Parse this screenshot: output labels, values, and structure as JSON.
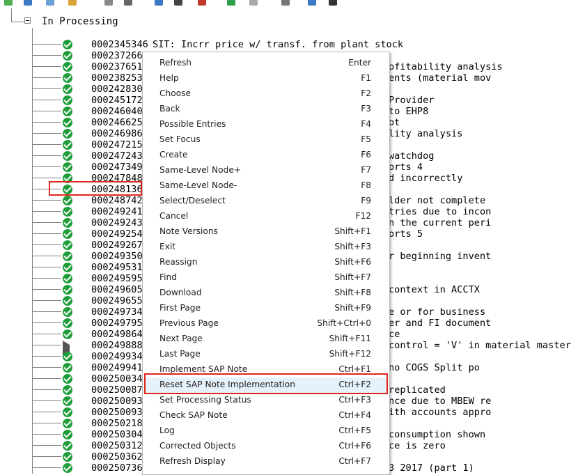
{
  "tree": {
    "root_label": "In Processing",
    "rows": [
      {
        "number": "0002345346",
        "desc": "SIT: Incrr price w/ transf. from plant stock",
        "full": true,
        "status": "check"
      },
      {
        "number": "000237266",
        "desc": "",
        "status": "check"
      },
      {
        "number": "000237651",
        "desc": "ofitability analysis",
        "status": "check"
      },
      {
        "number": "000238253",
        "desc": "ents (material mov",
        "status": "check"
      },
      {
        "number": "000242830",
        "desc": "",
        "status": "check"
      },
      {
        "number": "000245172",
        "desc": "Provider",
        "status": "check"
      },
      {
        "number": "000246040",
        "desc": "to EHP8",
        "status": "check"
      },
      {
        "number": "000246625",
        "desc": "ot",
        "status": "check"
      },
      {
        "number": "000246986",
        "desc": "lity analysis",
        "status": "check"
      },
      {
        "number": "000247215",
        "desc": "",
        "status": "check"
      },
      {
        "number": "000247243",
        "desc": "watchdog",
        "status": "check"
      },
      {
        "number": "000247349",
        "desc": "orts 4",
        "status": "check"
      },
      {
        "number": "000247848",
        "desc": "d incorrectly",
        "status": "check"
      },
      {
        "number": "000248136",
        "desc": "",
        "status": "check",
        "selected": true
      },
      {
        "number": "000248742",
        "desc": "lder not complete",
        "status": "check"
      },
      {
        "number": "000249241",
        "desc": "tries due to incon",
        "status": "check"
      },
      {
        "number": "000249243",
        "desc": "n the current peri",
        "status": "check"
      },
      {
        "number": "000249254",
        "desc": "orts 5",
        "status": "check"
      },
      {
        "number": "000249267",
        "desc": "",
        "status": "check"
      },
      {
        "number": "000249350",
        "desc": "r beginning invent",
        "status": "check"
      },
      {
        "number": "000249531",
        "desc": "",
        "status": "check"
      },
      {
        "number": "000249595",
        "desc": "",
        "status": "check"
      },
      {
        "number": "000249605",
        "desc": " context in ACCTX",
        "status": "check"
      },
      {
        "number": "000249655",
        "desc": "",
        "status": "check"
      },
      {
        "number": "000249734",
        "desc": "e or for business",
        "status": "check"
      },
      {
        "number": "000249795",
        "desc": "er and FI document",
        "status": "check"
      },
      {
        "number": "000249864",
        "desc": "ce",
        "status": "check"
      },
      {
        "number": "000249888",
        "desc": "control = 'V' in material master",
        "status": "triangle"
      },
      {
        "number": "000249934",
        "desc": "",
        "status": "check"
      },
      {
        "number": "000249941",
        "desc": " no COGS Split po",
        "status": "check"
      },
      {
        "number": "000250034",
        "desc": "",
        "status": "check"
      },
      {
        "number": "000250087",
        "desc": " replicated",
        "status": "check"
      },
      {
        "number": "000250093",
        "desc": "nce due to MBEW re",
        "status": "check"
      },
      {
        "number": "000250093",
        "desc": "ith accounts appro",
        "status": "check"
      },
      {
        "number": "000250218",
        "desc": "",
        "status": "check"
      },
      {
        "number": "000250304",
        "desc": "consumption shown",
        "status": "check"
      },
      {
        "number": "000250312",
        "desc": "ce is zero",
        "status": "check"
      },
      {
        "number": "000250362",
        "desc": "",
        "status": "check"
      },
      {
        "number": "000250736",
        "desc": "3 2017 (part 1)",
        "status": "check"
      }
    ]
  },
  "context_menu": {
    "items": [
      {
        "label": "Refresh",
        "shortcut": "Enter"
      },
      {
        "label": "Help",
        "shortcut": "F1"
      },
      {
        "label": "Choose",
        "shortcut": "F2"
      },
      {
        "label": "Back",
        "shortcut": "F3"
      },
      {
        "label": "Possible Entries",
        "shortcut": "F4"
      },
      {
        "label": "Set Focus",
        "shortcut": "F5"
      },
      {
        "label": "Create",
        "shortcut": "F6"
      },
      {
        "label": "Same-Level Node+",
        "shortcut": "F7"
      },
      {
        "label": "Same-Level Node-",
        "shortcut": "F8"
      },
      {
        "label": "Select/Deselect",
        "shortcut": "F9"
      },
      {
        "label": "Cancel",
        "shortcut": "F12"
      },
      {
        "label": "Note Versions",
        "shortcut": "Shift+F1"
      },
      {
        "label": "Exit",
        "shortcut": "Shift+F3"
      },
      {
        "label": "Reassign",
        "shortcut": "Shift+F6"
      },
      {
        "label": "Find",
        "shortcut": "Shift+F7"
      },
      {
        "label": "Download",
        "shortcut": "Shift+F8"
      },
      {
        "label": "First Page",
        "shortcut": "Shift+F9"
      },
      {
        "label": "Previous Page",
        "shortcut": "Shift+Ctrl+0"
      },
      {
        "label": "Next Page",
        "shortcut": "Shift+F11"
      },
      {
        "label": "Last Page",
        "shortcut": "Shift+F12"
      },
      {
        "label": "Implement SAP Note",
        "shortcut": "Ctrl+F1"
      },
      {
        "label": "Reset SAP Note Implementation",
        "shortcut": "Ctrl+F2",
        "hover": true
      },
      {
        "label": "Set Processing Status",
        "shortcut": "Ctrl+F3"
      },
      {
        "label": "Check SAP Note",
        "shortcut": "Ctrl+F4"
      },
      {
        "label": "Log",
        "shortcut": "Ctrl+F5"
      },
      {
        "label": "Corrected Objects",
        "shortcut": "Ctrl+F6"
      },
      {
        "label": "Refresh Display",
        "shortcut": "Ctrl+F7"
      }
    ]
  },
  "colors": {
    "check": "#1f9d3a",
    "highlight_box": "#e0261b",
    "menu_hover": "#e5f1fb"
  }
}
